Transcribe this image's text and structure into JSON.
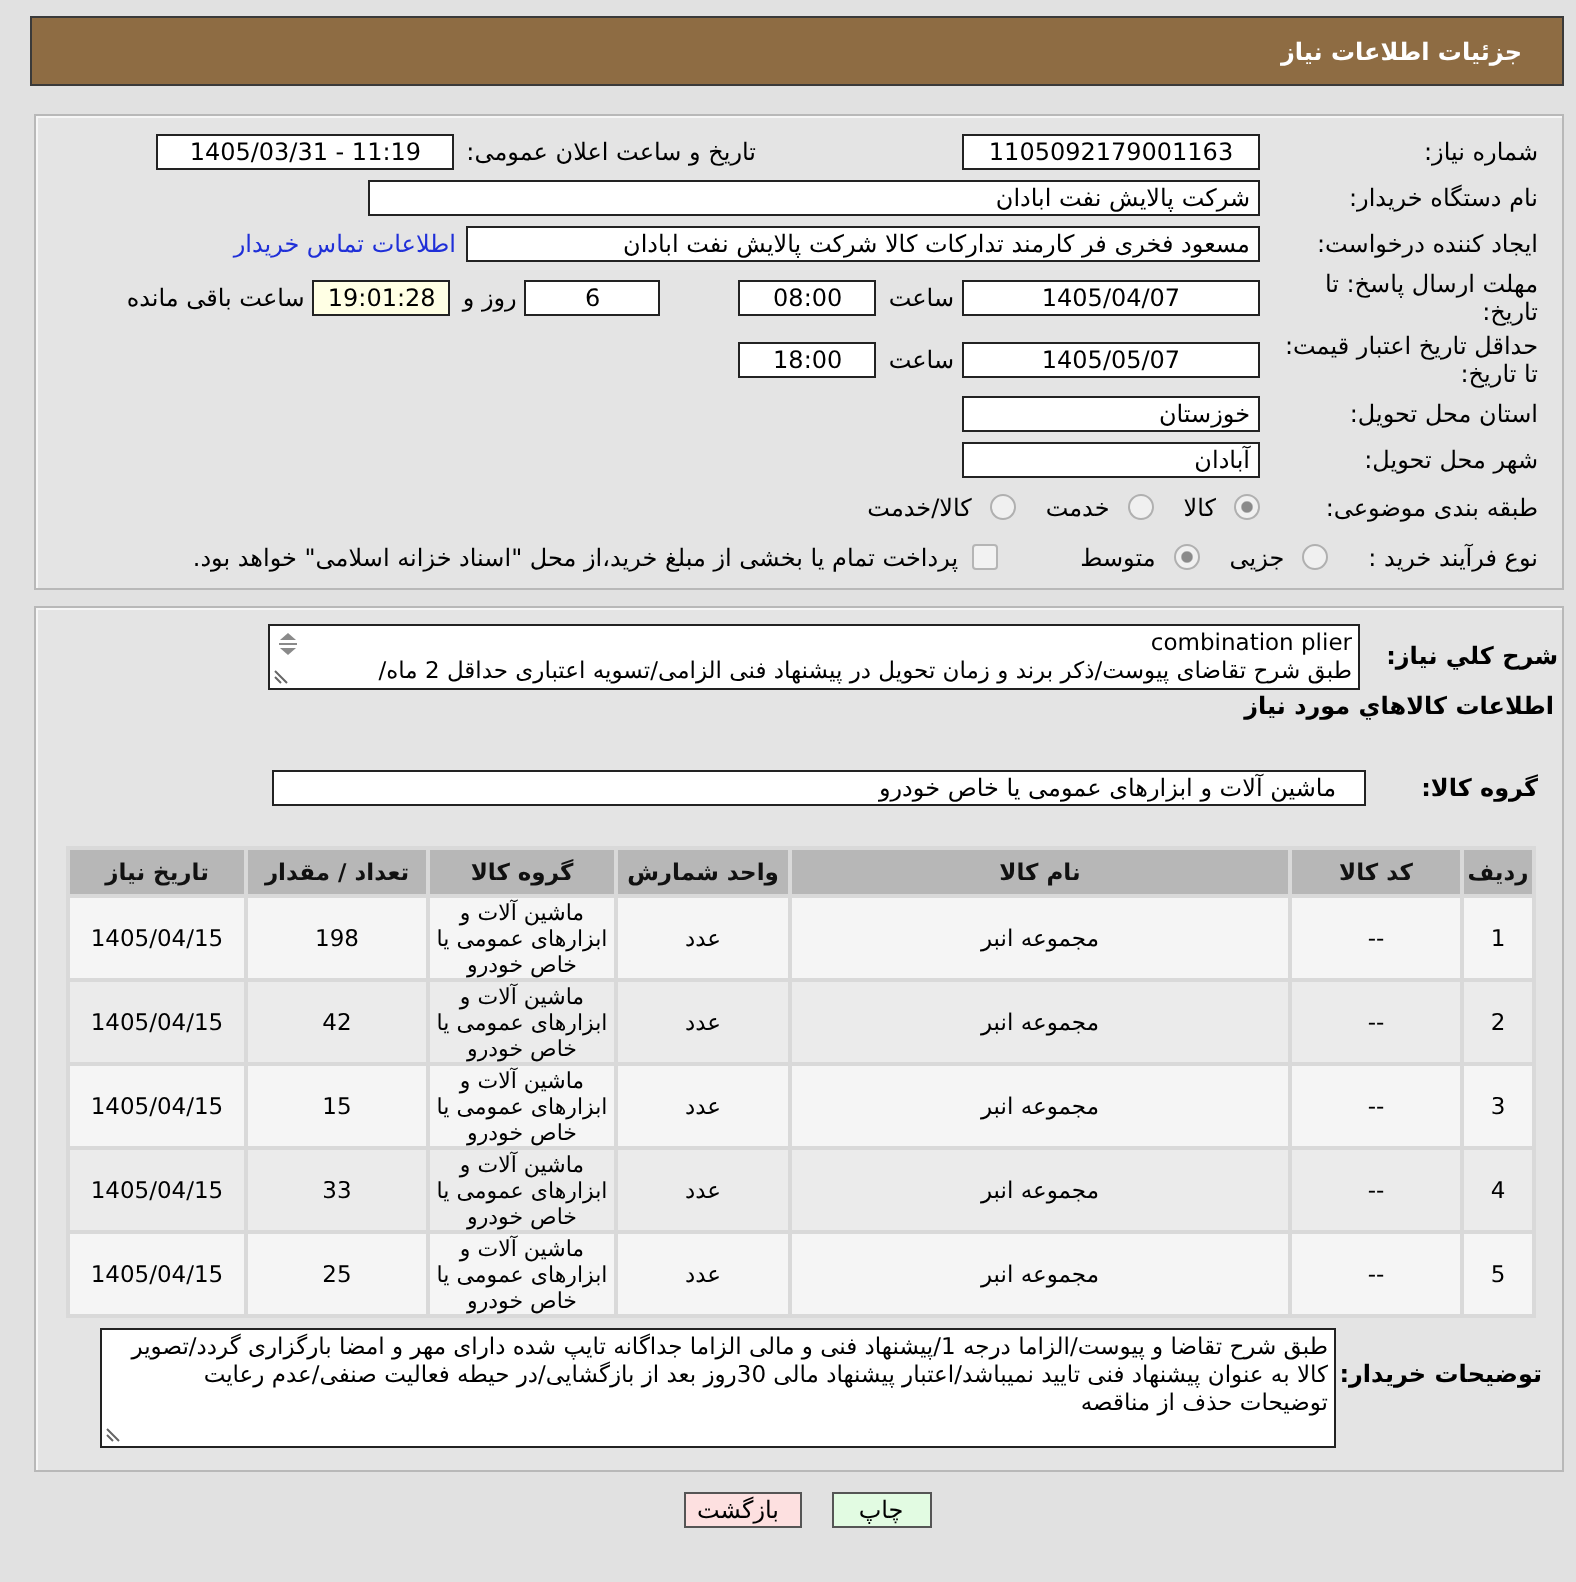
{
  "header": {
    "title": "جزئیات اطلاعات نیاز"
  },
  "details": {
    "need_number": {
      "label": "شماره نیاز:",
      "value": "1105092179001163"
    },
    "announcement": {
      "label": "تاریخ و ساعت اعلان عمومی:",
      "value": "1405/03/31 - 11:19"
    },
    "buyer_organization": {
      "label": "نام دستگاه خریدار:",
      "value": "شرکت پالایش نفت ابادان"
    },
    "requester": {
      "label": "ایجاد کننده درخواست:",
      "value": "مسعود فخری فر کارمند تدارکات کالا شرکت پالایش نفت ابادان",
      "contact_link": "اطلاعات تماس خریدار"
    },
    "response_deadline": {
      "label": "مهلت ارسال پاسخ: تا تاریخ:",
      "date": "1405/04/07",
      "time_label": "ساعت",
      "time": "08:00",
      "days": "6",
      "days_label": "روز و",
      "remaining": "19:01:28",
      "remaining_label": "ساعت باقی مانده"
    },
    "price_validity": {
      "label": "حداقل تاریخ اعتبار قیمت: تا تاریخ:",
      "date": "1405/05/07",
      "time_label": "ساعت",
      "time": "18:00"
    },
    "delivery_province": {
      "label": "استان محل تحویل:",
      "value": "خوزستان"
    },
    "delivery_city": {
      "label": "شهر محل تحویل:",
      "value": "آبادان"
    },
    "category": {
      "label": "طبقه بندی موضوعی:",
      "options": [
        {
          "label": "کالا",
          "selected": true
        },
        {
          "label": "خدمت",
          "selected": false
        },
        {
          "label": "کالا/خدمت",
          "selected": false
        }
      ]
    },
    "purchase_type": {
      "label": "نوع فرآیند خرید :",
      "options": [
        {
          "label": "جزیی",
          "selected": false
        },
        {
          "label": "متوسط",
          "selected": true
        }
      ],
      "treasury_payment": {
        "label": "پرداخت تمام یا بخشی از مبلغ خرید،از محل \"اسناد خزانه اسلامی\" خواهد بود.",
        "checked": false
      }
    }
  },
  "summary": {
    "label": "شرح كلي نياز:",
    "value": "combination plier\nطبق شرح تقاضای پیوست/ذکر برند و زمان تحویل در پیشنهاد فنی الزامی/تسویه اعتباری حداقل 2 ماه/"
  },
  "goods": {
    "heading": "اطلاعات كالاهاي مورد نياز",
    "group_label": "گروه کالا:",
    "group_value": "ماشین آلات و ابزارهای عمومی یا خاص خودرو",
    "table": {
      "columns": [
        "ردیف",
        "کد کالا",
        "نام کالا",
        "واحد شمارش",
        "گروه کالا",
        "تعداد / مقدار",
        "تاریخ نیاز"
      ],
      "rows": [
        [
          "1",
          "--",
          "مجموعه انبر",
          "عدد",
          "ماشین آلات و ابزارهای عمومی یا خاص خودرو",
          "198",
          "1405/04/15"
        ],
        [
          "2",
          "--",
          "مجموعه انبر",
          "عدد",
          "ماشین آلات و ابزارهای عمومی یا خاص خودرو",
          "42",
          "1405/04/15"
        ],
        [
          "3",
          "--",
          "مجموعه انبر",
          "عدد",
          "ماشین آلات و ابزارهای عمومی یا خاص خودرو",
          "15",
          "1405/04/15"
        ],
        [
          "4",
          "--",
          "مجموعه انبر",
          "عدد",
          "ماشین آلات و ابزارهای عمومی یا خاص خودرو",
          "33",
          "1405/04/15"
        ],
        [
          "5",
          "--",
          "مجموعه انبر",
          "عدد",
          "ماشین آلات و ابزارهای عمومی یا خاص خودرو",
          "25",
          "1405/04/15"
        ]
      ]
    }
  },
  "buyer_notes": {
    "label": "توضیحات خریدار:",
    "value": "طبق شرح تقاضا و پیوست/الزاما درجه 1/پیشنهاد فنی و مالی الزاما جداگانه تایپ شده دارای مهر و امضا بارگزاری گردد/تصویر کالا به عنوان پیشنهاد فنی تایید نمیباشد/اعتبار پیشنهاد مالی 30روز بعد از بازگشایی/در حیطه فعالیت صنفی/عدم رعایت توضیحات حذف از مناقصه"
  },
  "buttons": [
    {
      "label": "چاپ",
      "kind": "print"
    },
    {
      "label": "بازگشت",
      "kind": "back"
    }
  ]
}
